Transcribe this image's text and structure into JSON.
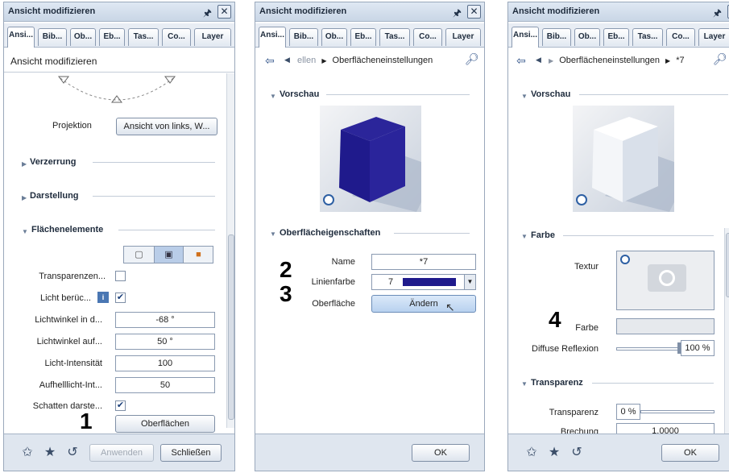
{
  "panels": [
    {
      "title": "Ansicht modifizieren",
      "tabs": [
        "Ansi...",
        "Bib...",
        "Ob...",
        "Eb...",
        "Tas...",
        "Co...",
        "Layer"
      ],
      "subtitle": "Ansicht modifizieren",
      "projection": {
        "label": "Projektion",
        "value": "Ansicht von links, W..."
      },
      "sections": [
        "Verzerrung",
        "Darstellung",
        "Flächenelemente"
      ],
      "rows": [
        {
          "label": "Transparenzen...",
          "kind": "checkbox",
          "checked": false
        },
        {
          "label": "Licht berüc...",
          "kind": "checkbox",
          "checked": true
        },
        {
          "label": "Lichtwinkel in d...",
          "kind": "field",
          "value": "-68 °"
        },
        {
          "label": "Lichtwinkel auf...",
          "kind": "field",
          "value": "50 °"
        },
        {
          "label": "Licht-Intensität",
          "kind": "field",
          "value": "100"
        },
        {
          "label": "Aufhelllicht-Int...",
          "kind": "field",
          "value": "50"
        },
        {
          "label": "Schatten darste...",
          "kind": "checkbox",
          "checked": true
        }
      ],
      "surfaces_button": "Oberflächen",
      "step": "1",
      "apply_button": "Anwenden",
      "close_button": "Schließen"
    },
    {
      "title": "Ansicht modifizieren",
      "tabs": [
        "Ansi...",
        "Bib...",
        "Ob...",
        "Eb...",
        "Tas...",
        "Co...",
        "Layer"
      ],
      "breadcrumb": [
        "ellen",
        "Oberflächeneinstellungen"
      ],
      "preview_section": "Vorschau",
      "props_section": "Oberflächeigenschaften",
      "name_label": "Name",
      "name_value": "*7",
      "line_color_label": "Linienfarbe",
      "line_color_value": "7",
      "surface_label": "Oberfläche",
      "change_button": "Ändern",
      "steps": [
        "2",
        "3"
      ],
      "ok_button": "OK",
      "cube_color": "#1f1a8c"
    },
    {
      "title": "Ansicht modifizieren",
      "tabs": [
        "Ansi...",
        "Bib...",
        "Ob...",
        "Eb...",
        "Tas...",
        "Co...",
        "Layer"
      ],
      "breadcrumb": [
        "Oberflächeneinstellungen",
        "*7"
      ],
      "preview_section": "Vorschau",
      "color_section": "Farbe",
      "texture_label": "Textur",
      "color_label": "Farbe",
      "diffuse_label": "Diffuse Reflexion",
      "diffuse_value": "100 %",
      "diffuse_level": 1.0,
      "transparency_section": "Transparenz",
      "transparency_label": "Transparenz",
      "transparency_value": "0 %",
      "refraction_label": "Brechung",
      "refraction_value": "1.0000",
      "step": "4",
      "ok_button": "OK",
      "cube_color": "#f4f6f9"
    }
  ]
}
